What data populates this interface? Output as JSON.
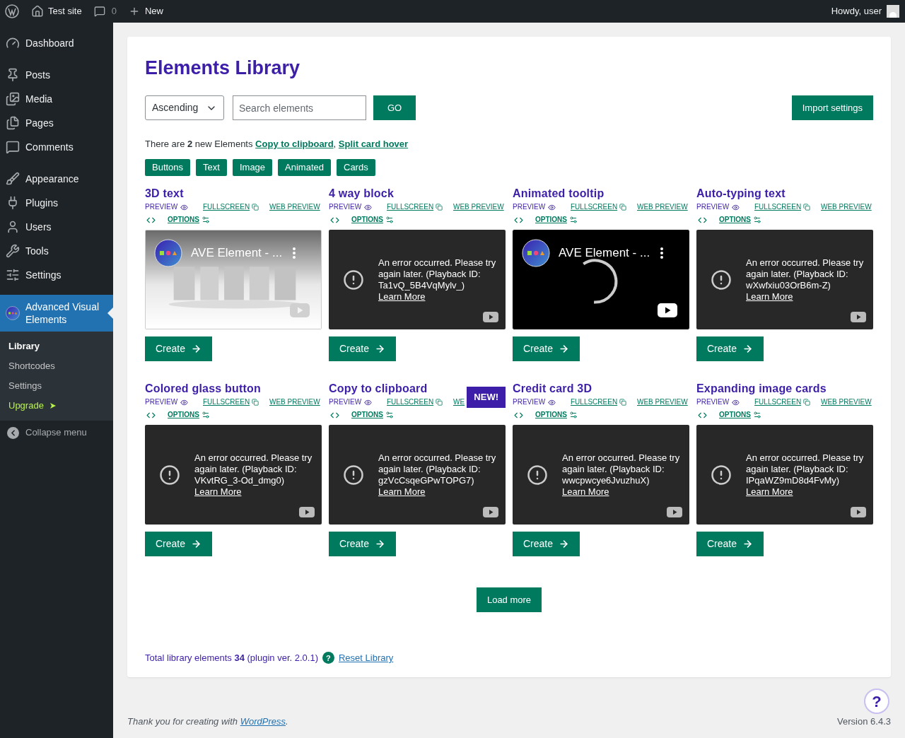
{
  "admin_bar": {
    "site": "Test site",
    "comments": "0",
    "new": "New",
    "greeting": "Howdy, user"
  },
  "sidebar": {
    "items": [
      {
        "label": "Dashboard",
        "selected": false
      },
      {
        "label": "Posts",
        "selected": false
      },
      {
        "label": "Media",
        "selected": false
      },
      {
        "label": "Pages",
        "selected": false
      },
      {
        "label": "Comments",
        "selected": false
      },
      {
        "label": "Appearance",
        "selected": false
      },
      {
        "label": "Plugins",
        "selected": false
      },
      {
        "label": "Users",
        "selected": false
      },
      {
        "label": "Tools",
        "selected": false
      },
      {
        "label": "Settings",
        "selected": false
      },
      {
        "label": "Advanced Visual Elements",
        "selected": true
      }
    ],
    "submenu": [
      {
        "label": "Library",
        "kind": "link",
        "selected": true
      },
      {
        "label": "Shortcodes",
        "kind": "link",
        "selected": false
      },
      {
        "label": "Settings",
        "kind": "link",
        "selected": false
      },
      {
        "label": "Upgrade",
        "kind": "upgrade",
        "selected": false
      }
    ],
    "collapse": "Collapse menu"
  },
  "page": {
    "title": "Elements Library",
    "sort": {
      "value": "Ascending"
    },
    "search": {
      "placeholder": "Search elements"
    },
    "go": "GO",
    "import": "Import settings",
    "notice": {
      "text": "There are **2** new Elements",
      "links": [
        "Copy to clipboard",
        "Split card hover"
      ],
      "separator": ","
    },
    "filters": [
      "Buttons",
      "Text",
      "Image",
      "Animated",
      "Cards"
    ],
    "cards": [
      {
        "title": "3D text",
        "preview": "PREVIEW",
        "fullscreen": "FULLSCREEN",
        "web_preview": "WEB PREVIEW",
        "options": "OPTIONS",
        "video": {
          "kind": "thumbnail",
          "title": "AVE Element - ..."
        },
        "create": "Create"
      },
      {
        "title": "4 way block",
        "preview": "PREVIEW",
        "fullscreen": "FULLSCREEN",
        "web_preview": "WEB PREVIEW",
        "options": "OPTIONS",
        "video": {
          "kind": "error",
          "message": "An error occurred. Please try again later. (Playback ID: Ta1vQ_5B4VqMylv_)",
          "link": "Learn More"
        },
        "create": "Create"
      },
      {
        "title": "Animated tooltip",
        "preview": "PREVIEW",
        "fullscreen": "FULLSCREEN",
        "web_preview": "WEB PREVIEW",
        "options": "OPTIONS",
        "video": {
          "kind": "loading",
          "title": "AVE Element - ..."
        },
        "create": "Create"
      },
      {
        "title": "Auto-typing text",
        "preview": "PREVIEW",
        "fullscreen": "FULLSCREEN",
        "web_preview": "WEB PREVIEW",
        "options": "OPTIONS",
        "video": {
          "kind": "error",
          "message": "An error occurred. Please try again later. (Playback ID: wXwfxiu03OrB6m-Z)",
          "link": "Learn More"
        },
        "create": "Create"
      },
      {
        "title": "Colored glass button",
        "preview": "PREVIEW",
        "fullscreen": "FULLSCREEN",
        "web_preview": "WEB PREVIEW",
        "options": "OPTIONS",
        "video": {
          "kind": "error",
          "message": "An error occurred. Please try again later. (Playback ID: VKvtRG_3-Od_dmg0)",
          "link": "Learn More"
        },
        "create": "Create"
      },
      {
        "title": "Copy to clipboard",
        "badge": "NEW!",
        "preview": "PREVIEW",
        "fullscreen": "FULLSCREEN",
        "web_preview": "WE",
        "options": "OPTIONS",
        "video": {
          "kind": "error",
          "message": "An error occurred. Please try again later. (Playback ID: gzVcCsqeGPwTOPG7)",
          "link": "Learn More"
        },
        "create": "Create"
      },
      {
        "title": "Credit card 3D",
        "preview": "PREVIEW",
        "fullscreen": "FULLSCREEN",
        "web_preview": "WEB PREVIEW",
        "options": "OPTIONS",
        "video": {
          "kind": "error",
          "message": "An error occurred. Please try again later. (Playback ID: wwcpwcye6JvuzhuX)",
          "link": "Learn More"
        },
        "create": "Create"
      },
      {
        "title": "Expanding image cards",
        "preview": "PREVIEW",
        "fullscreen": "FULLSCREEN",
        "web_preview": "WEB PREVIEW",
        "options": "OPTIONS",
        "video": {
          "kind": "error",
          "message": "An error occurred. Please try again later. (Playback ID: IPqaWZ9mD8d4FvMy)",
          "link": "Learn More"
        },
        "create": "Create"
      }
    ],
    "load_more": "Load more",
    "total": "Total library elements **34** (plugin ver. 2.0.1)",
    "help": "?",
    "reset": "Reset Library"
  },
  "footer": {
    "thanks": "Thank you for creating with",
    "link": "WordPress",
    "period": ".",
    "version": "Version 6.4.3",
    "help": "?"
  }
}
